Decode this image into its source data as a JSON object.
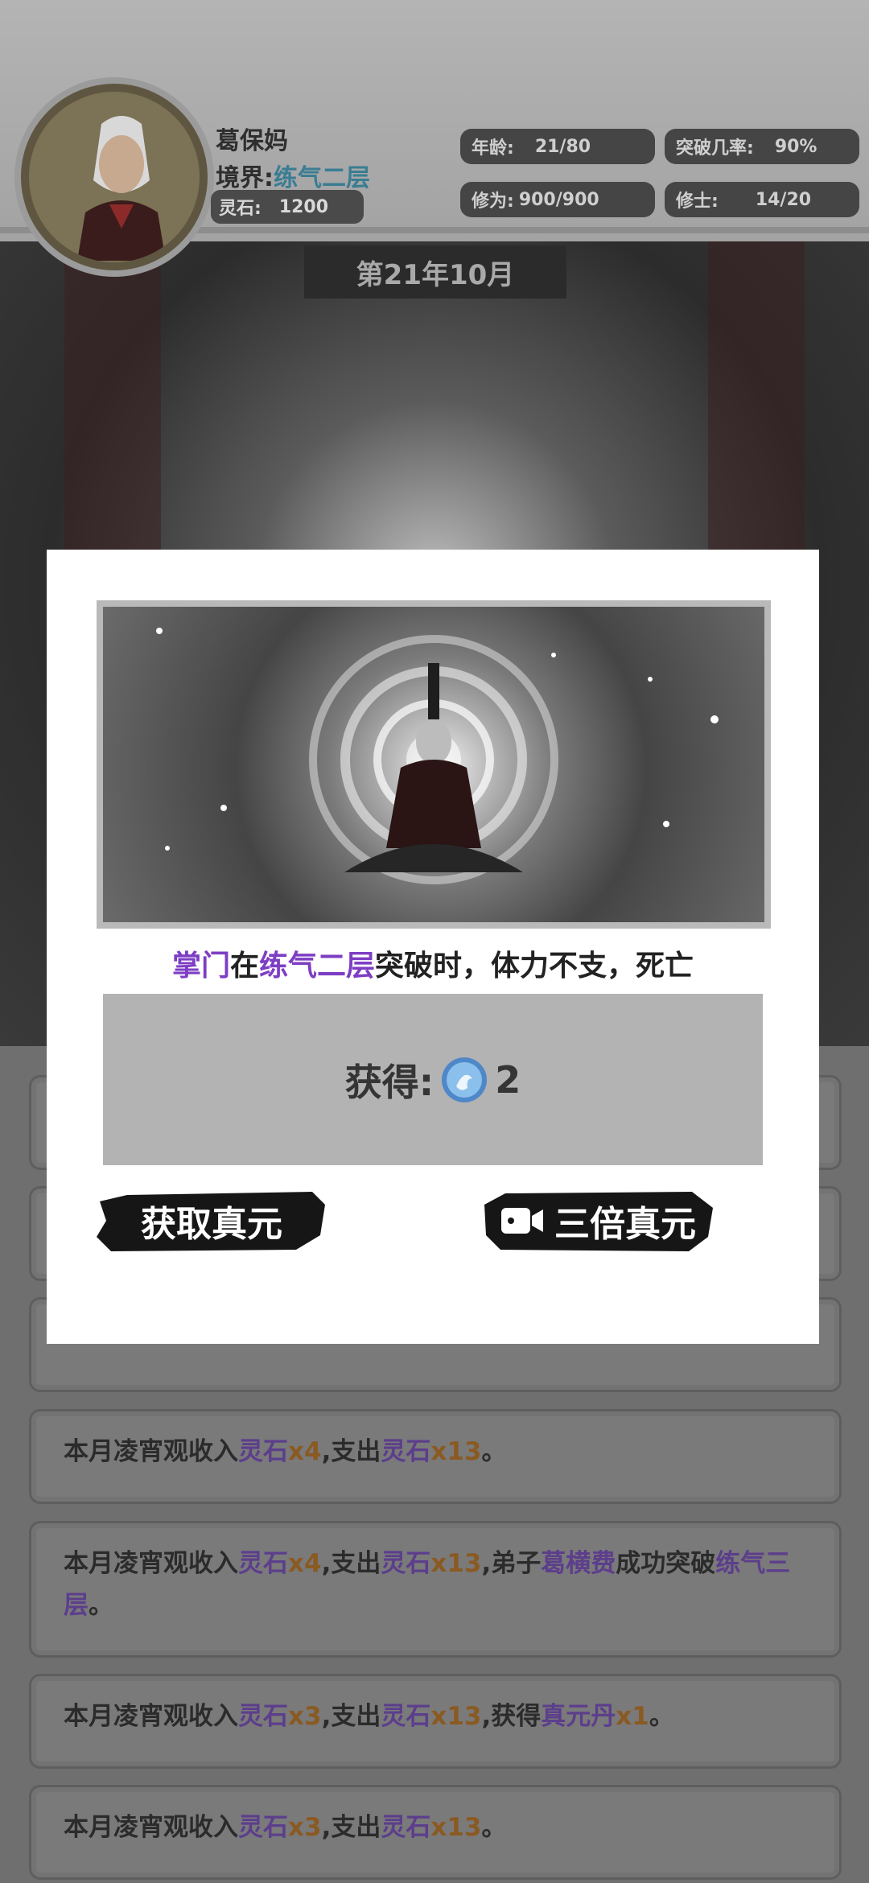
{
  "header": {
    "name": "葛保妈",
    "realm_label": "境界:",
    "realm_value": "练气二层",
    "stone_label": "灵石:",
    "stone_value": "1200",
    "stats": [
      {
        "label": "年龄:",
        "value": "21/80"
      },
      {
        "label": "突破几率:",
        "value": "90%"
      },
      {
        "label": "修为:",
        "value": "900/900"
      },
      {
        "label": "修士:",
        "value": "14/20"
      }
    ],
    "date": "第21年10月"
  },
  "logs": [
    {
      "segments": [
        {
          "t": "本月凌宵观收入",
          "c": ""
        },
        {
          "t": "灵石",
          "c": "p"
        },
        {
          "t": "x4",
          "c": "o"
        },
        {
          "t": ",支出",
          "c": ""
        },
        {
          "t": "灵石",
          "c": "p"
        },
        {
          "t": "x13",
          "c": "o"
        },
        {
          "t": "。",
          "c": ""
        }
      ]
    },
    {
      "segments": [
        {
          "t": "本月凌宵观收入",
          "c": ""
        },
        {
          "t": "灵石",
          "c": "p"
        },
        {
          "t": "x4",
          "c": "o"
        },
        {
          "t": ",支出",
          "c": ""
        },
        {
          "t": "灵石",
          "c": "p"
        },
        {
          "t": "x13",
          "c": "o"
        },
        {
          "t": ",弟子",
          "c": ""
        },
        {
          "t": "葛横费",
          "c": "p"
        },
        {
          "t": "成功突破",
          "c": ""
        },
        {
          "t": "练气三层",
          "c": "p"
        },
        {
          "t": "。",
          "c": ""
        }
      ]
    },
    {
      "segments": [
        {
          "t": "本月凌宵观收入",
          "c": ""
        },
        {
          "t": "灵石",
          "c": "p"
        },
        {
          "t": "x3",
          "c": "o"
        },
        {
          "t": ",支出",
          "c": ""
        },
        {
          "t": "灵石",
          "c": "p"
        },
        {
          "t": "x13",
          "c": "o"
        },
        {
          "t": ",获得",
          "c": ""
        },
        {
          "t": "真元丹",
          "c": "p"
        },
        {
          "t": "x1",
          "c": "o"
        },
        {
          "t": "。",
          "c": ""
        }
      ]
    },
    {
      "segments": [
        {
          "t": "本月凌宵观收入",
          "c": ""
        },
        {
          "t": "灵石",
          "c": "p"
        },
        {
          "t": "x3",
          "c": "o"
        },
        {
          "t": ",支出",
          "c": ""
        },
        {
          "t": "灵石",
          "c": "p"
        },
        {
          "t": "x13",
          "c": "o"
        },
        {
          "t": "。",
          "c": ""
        }
      ]
    }
  ],
  "modal": {
    "message": [
      {
        "t": "掌门",
        "c": "p"
      },
      {
        "t": "在",
        "c": ""
      },
      {
        "t": "练气二层",
        "c": "p"
      },
      {
        "t": "突破时，体力不支，死亡",
        "c": ""
      }
    ],
    "reward_label": "获得:",
    "reward_icon": "true-essence-orb-icon",
    "reward_amount": "2",
    "claim_button": "获取真元",
    "triple_button": "三倍真元",
    "triple_icon": "video-icon"
  },
  "colors": {
    "accent_purple": "#7e3ec4",
    "accent_orange": "#8a5a23",
    "realm_blue": "#3a7d93"
  }
}
